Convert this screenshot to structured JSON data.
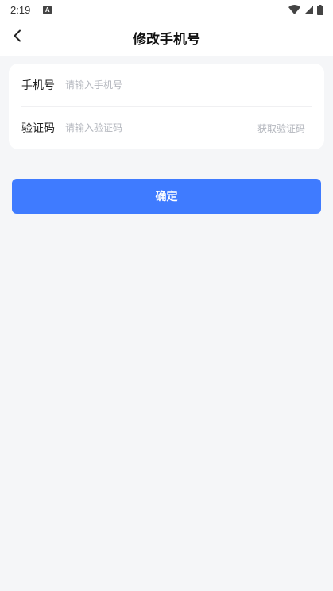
{
  "status_bar": {
    "time": "2:19",
    "notification_icon": "a-letter-icon",
    "icons": [
      "wifi-icon",
      "signal-icon",
      "battery-icon"
    ]
  },
  "nav": {
    "back_icon": "chevron-left-icon",
    "title": "修改手机号"
  },
  "form": {
    "phone_label": "手机号",
    "phone_value": "",
    "phone_placeholder": "请输入手机号",
    "code_label": "验证码",
    "code_value": "",
    "code_placeholder": "请输入验证码",
    "get_code_label": "获取验证码"
  },
  "confirm_label": "确定",
  "colors": {
    "background": "#f5f6f8",
    "primary": "#3f7bff",
    "placeholder": "#b3b6bd"
  }
}
